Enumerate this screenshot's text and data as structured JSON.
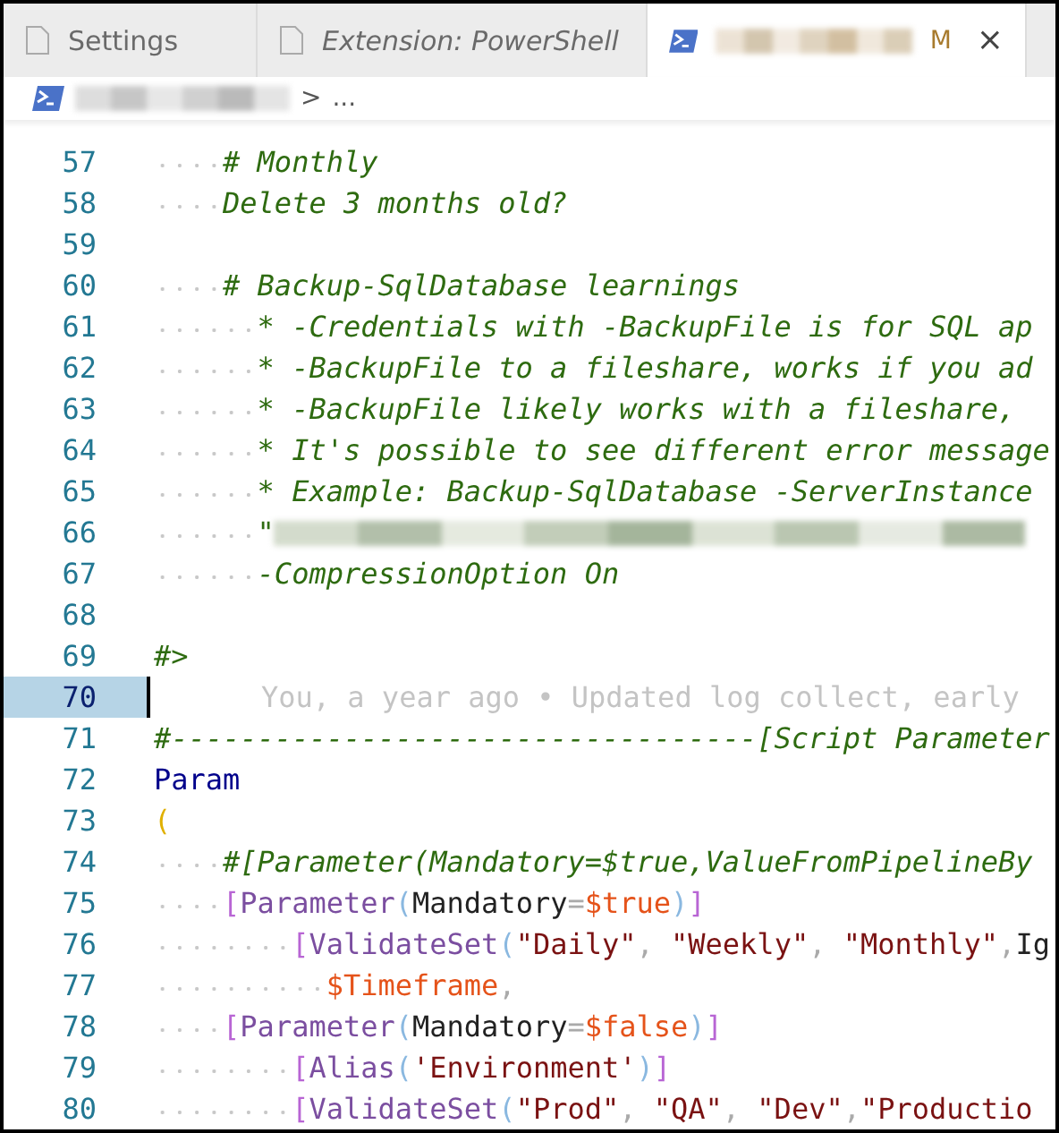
{
  "tabs": [
    {
      "kind": "file",
      "label": "Settings",
      "italic": false,
      "selected": false
    },
    {
      "kind": "file",
      "label": "Extension: PowerShell",
      "italic": true,
      "selected": false
    },
    {
      "kind": "powershell",
      "status": "M",
      "close": "×",
      "selected": true
    }
  ],
  "breadcrumb": {
    "separator": ">",
    "more": "..."
  },
  "blame": "You, a year ago • Updated log collect, early",
  "lines": [
    {
      "number": "57",
      "current": false,
      "tokens": [
        {
          "kind": "comment",
          "text": "    # Monthly"
        }
      ]
    },
    {
      "number": "58",
      "current": false,
      "tokens": [
        {
          "kind": "comment",
          "text": "    Delete 3 months old?"
        }
      ]
    },
    {
      "number": "59",
      "current": false
    },
    {
      "number": "60",
      "current": false,
      "tokens": [
        {
          "kind": "comment",
          "text": "    # Backup-SqlDatabase learnings"
        }
      ]
    },
    {
      "number": "61",
      "current": false,
      "tokens": [
        {
          "kind": "comment",
          "text": "      * -Credentials with -BackupFile is for SQL ap"
        }
      ]
    },
    {
      "number": "62",
      "current": false,
      "tokens": [
        {
          "kind": "comment",
          "text": "      * -BackupFile to a fileshare, works if you ad"
        }
      ]
    },
    {
      "number": "63",
      "current": false,
      "tokens": [
        {
          "kind": "comment",
          "text": "      * -BackupFile likely works with a fileshare,"
        }
      ]
    },
    {
      "number": "64",
      "current": false,
      "tokens": [
        {
          "kind": "comment",
          "text": "      * It's possible to see different error message"
        }
      ]
    },
    {
      "number": "65",
      "current": false,
      "tokens": [
        {
          "kind": "comment",
          "text": "      * Example: Backup-SqlDatabase -ServerInstance"
        }
      ]
    },
    {
      "number": "66",
      "current": false,
      "tokens": [
        {
          "kind": "comment",
          "text": "      \""
        },
        {
          "kind": "redacted"
        }
      ]
    },
    {
      "number": "67",
      "current": false,
      "tokens": [
        {
          "kind": "comment",
          "text": "      -CompressionOption On"
        }
      ]
    },
    {
      "number": "68",
      "current": false
    },
    {
      "number": "69",
      "current": false,
      "tokens": [
        {
          "kind": "comment",
          "text": "#>"
        }
      ]
    },
    {
      "number": "70",
      "current": true
    },
    {
      "number": "71",
      "current": false,
      "tokens": [
        {
          "kind": "comment",
          "text": "#----------------------------------[Script Parameter"
        }
      ]
    },
    {
      "number": "72",
      "current": false,
      "tokens": [
        {
          "kind": "keyword",
          "text": "Param"
        }
      ]
    },
    {
      "number": "73",
      "current": false,
      "tokens": [
        {
          "kind": "paren",
          "text": "("
        }
      ]
    },
    {
      "number": "74",
      "current": false,
      "tokens": [
        {
          "kind": "comment",
          "text": "    #[Parameter(Mandatory=$true,ValueFromPipelineBy"
        }
      ]
    },
    {
      "number": "75",
      "current": false,
      "tokens": [
        {
          "kind": "bracket",
          "text": "    ["
        },
        {
          "kind": "type",
          "text": "Parameter"
        },
        {
          "kind": "brace",
          "text": "("
        },
        {
          "kind": "name",
          "text": "Mandatory"
        },
        {
          "kind": "punct",
          "text": "="
        },
        {
          "kind": "variable",
          "text": "$true"
        },
        {
          "kind": "brace",
          "text": ")"
        },
        {
          "kind": "bracket",
          "text": "]"
        }
      ]
    },
    {
      "number": "76",
      "current": false,
      "tokens": [
        {
          "kind": "bracket",
          "text": "        ["
        },
        {
          "kind": "type",
          "text": "ValidateSet"
        },
        {
          "kind": "brace",
          "text": "("
        },
        {
          "kind": "string",
          "text": "\"Daily\""
        },
        {
          "kind": "punct",
          "text": ", "
        },
        {
          "kind": "string",
          "text": "\"Weekly\""
        },
        {
          "kind": "punct",
          "text": ", "
        },
        {
          "kind": "string",
          "text": "\"Monthly\""
        },
        {
          "kind": "punct",
          "text": ","
        },
        {
          "kind": "name",
          "text": "Ig"
        }
      ]
    },
    {
      "number": "77",
      "current": false,
      "tokens": [
        {
          "kind": "variable",
          "text": "          $Timeframe"
        },
        {
          "kind": "punct",
          "text": ","
        }
      ]
    },
    {
      "number": "78",
      "current": false,
      "tokens": [
        {
          "kind": "bracket",
          "text": "    ["
        },
        {
          "kind": "type",
          "text": "Parameter"
        },
        {
          "kind": "brace",
          "text": "("
        },
        {
          "kind": "name",
          "text": "Mandatory"
        },
        {
          "kind": "punct",
          "text": "="
        },
        {
          "kind": "variable",
          "text": "$false"
        },
        {
          "kind": "brace",
          "text": ")"
        },
        {
          "kind": "bracket",
          "text": "]"
        }
      ]
    },
    {
      "number": "79",
      "current": false,
      "tokens": [
        {
          "kind": "bracket",
          "text": "        ["
        },
        {
          "kind": "type",
          "text": "Alias"
        },
        {
          "kind": "brace",
          "text": "("
        },
        {
          "kind": "string",
          "text": "'Environment'"
        },
        {
          "kind": "brace",
          "text": ")"
        },
        {
          "kind": "bracket",
          "text": "]"
        }
      ]
    },
    {
      "number": "80",
      "current": false,
      "tokens": [
        {
          "kind": "bracket",
          "text": "        ["
        },
        {
          "kind": "type",
          "text": "ValidateSet"
        },
        {
          "kind": "brace",
          "text": "("
        },
        {
          "kind": "string",
          "text": "\"Prod\""
        },
        {
          "kind": "punct",
          "text": ", "
        },
        {
          "kind": "string",
          "text": "\"QA\""
        },
        {
          "kind": "punct",
          "text": ", "
        },
        {
          "kind": "string",
          "text": "\"Dev\""
        },
        {
          "kind": "punct",
          "text": ","
        },
        {
          "kind": "string",
          "text": "\"Productio"
        }
      ]
    }
  ]
}
